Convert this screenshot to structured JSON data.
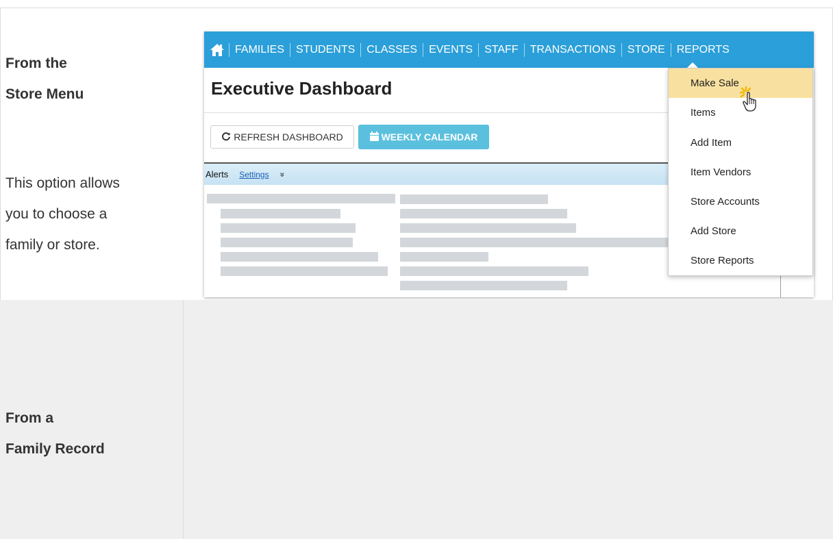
{
  "row1": {
    "step_title_line1": "From the",
    "step_title_line2": "Store Menu",
    "description_lines": [
      "This option allows",
      "you to choose a",
      "family or store."
    ]
  },
  "row2": {
    "step_title_line1": "From a",
    "step_title_line2": "Family Record"
  },
  "screenshot": {
    "nav": {
      "home_icon": "home-icon",
      "items": [
        "FAMILIES",
        "STUDENTS",
        "CLASSES",
        "EVENTS",
        "STAFF",
        "TRANSACTIONS",
        "STORE",
        "REPORTS"
      ]
    },
    "page_title": "Executive Dashboard",
    "buttons": {
      "refresh": "REFRESH DASHBOARD",
      "weekly": "WEEKLY CALENDAR"
    },
    "alerts": {
      "label": "Alerts",
      "settings": "Settings",
      "toggle_glyph": "»"
    },
    "store_menu": {
      "items": [
        "Make Sale",
        "Items",
        "Add Item",
        "Item Vendors",
        "Store Accounts",
        "Add Store",
        "Store Reports"
      ],
      "highlighted": "Make Sale"
    }
  },
  "colors": {
    "nav_blue": "#2b9fd9",
    "weekly_button": "#5bc0de",
    "menu_highlight": "#f8e0a0",
    "row2_background": "#efefef"
  }
}
